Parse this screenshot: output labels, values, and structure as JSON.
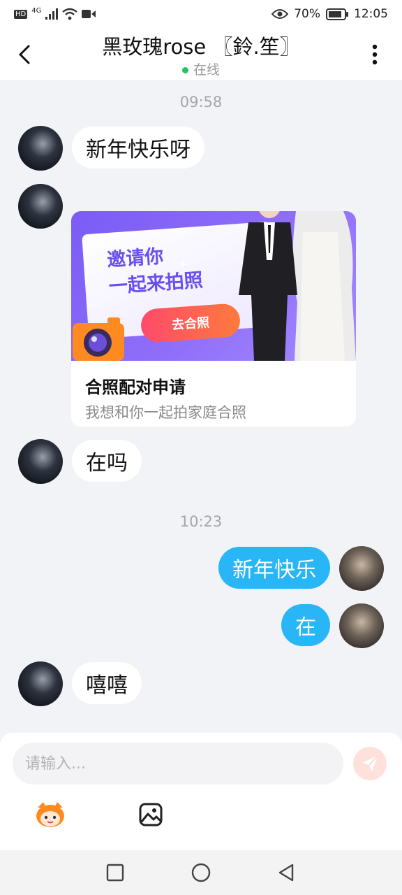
{
  "status_bar": {
    "hd": "HD",
    "network": "4G",
    "battery": "70%",
    "time": "12:05"
  },
  "header": {
    "title": "黑玫瑰rose 〖鈴.笙〗",
    "status": "在线"
  },
  "messages": {
    "time1": "09:58",
    "m1": "新年快乐呀",
    "card": {
      "invite_line1": "邀请你",
      "invite_line2": "一起来拍照",
      "button": "去合照",
      "title": "合照配对申请",
      "subtitle": "我想和你一起拍家庭合照"
    },
    "m2": "在吗",
    "time2": "10:23",
    "m3": "新年快乐",
    "m4": "在",
    "m5": "嘻嘻"
  },
  "composer": {
    "placeholder": "请输入..."
  },
  "colors": {
    "outgoing_bubble": "#29b6f6",
    "online_dot": "#22c55e",
    "card_gradient_start": "#7b5cf5",
    "go_button": "#ff4a6a"
  },
  "icons": {
    "back": "back-arrow-icon",
    "more": "more-vertical-icon",
    "send": "send-icon",
    "emoji": "mascot-emoji-icon",
    "image": "image-icon",
    "nav_recent": "square-icon",
    "nav_home": "circle-icon",
    "nav_back": "triangle-back-icon"
  }
}
